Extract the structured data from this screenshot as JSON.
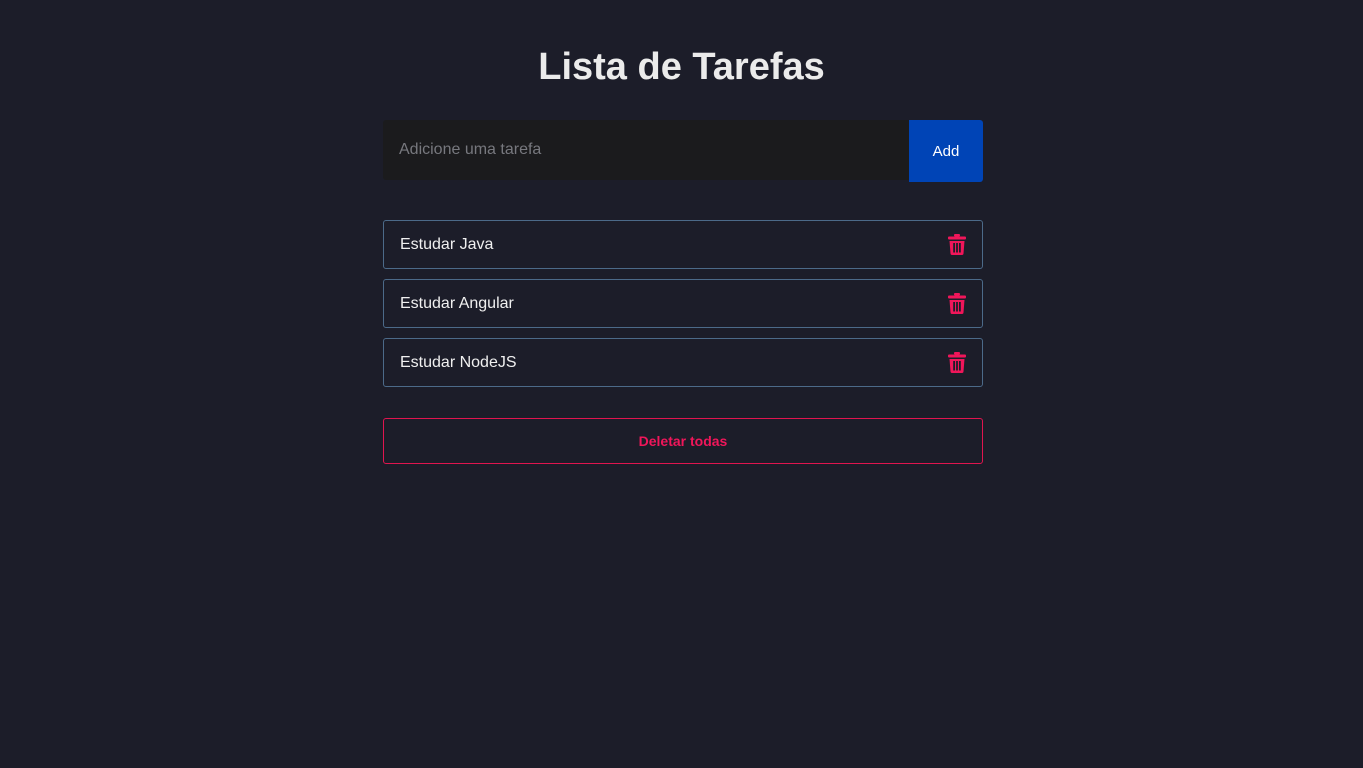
{
  "header": {
    "title": "Lista de Tarefas"
  },
  "form": {
    "input_value": "",
    "input_placeholder": "Adicione uma tarefa",
    "add_label": "Add"
  },
  "tasks": [
    {
      "label": "Estudar Java",
      "icon": "trash-icon"
    },
    {
      "label": "Estudar Angular",
      "icon": "trash-icon"
    },
    {
      "label": "Estudar NodeJS",
      "icon": "trash-icon"
    }
  ],
  "actions": {
    "delete_all_label": "Deletar todas"
  },
  "colors": {
    "background": "#1c1d29",
    "accent_blue": "#0044b6",
    "danger": "#f0165a",
    "task_border": "#4c6a89"
  }
}
